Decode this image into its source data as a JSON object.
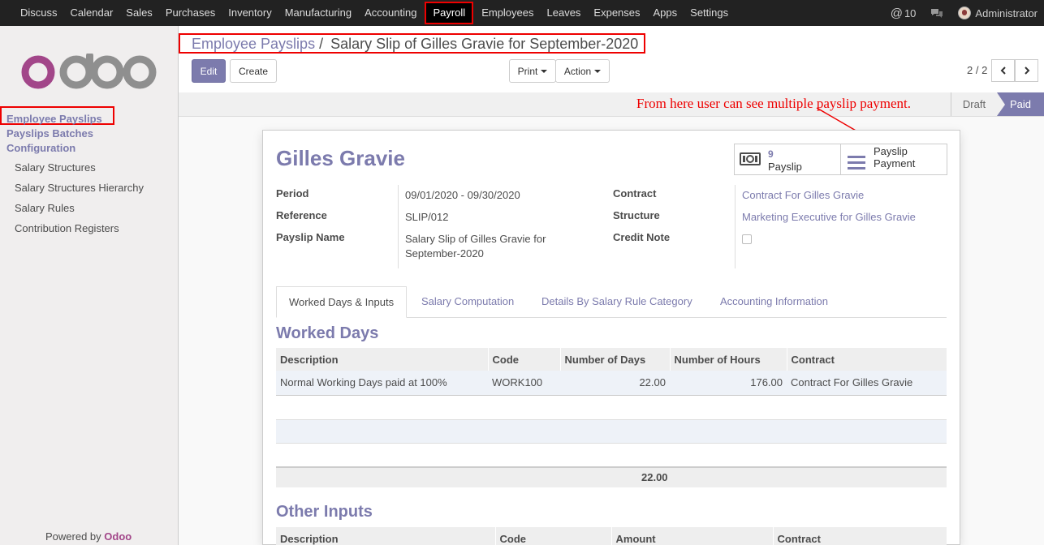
{
  "topbar": {
    "menu": [
      "Discuss",
      "Calendar",
      "Sales",
      "Purchases",
      "Inventory",
      "Manufacturing",
      "Accounting",
      "Payroll",
      "Employees",
      "Leaves",
      "Expenses",
      "Apps",
      "Settings"
    ],
    "active_menu": "Payroll",
    "activity_count": "10",
    "user": "Administrator"
  },
  "sidebar": {
    "logo_text": "odoo",
    "sections": [
      "Employee Payslips",
      "Payslips Batches",
      "Configuration"
    ],
    "config_items": [
      "Salary Structures",
      "Salary Structures Hierarchy",
      "Salary Rules",
      "Contribution Registers"
    ],
    "powered_prefix": "Powered by",
    "powered_brand": "Odoo"
  },
  "control": {
    "breadcrumb_parent": "Employee Payslips",
    "breadcrumb_sep": "/",
    "breadcrumb_current": "Salary Slip of Gilles Gravie for September-2020",
    "edit_label": "Edit",
    "create_label": "Create",
    "print_label": "Print",
    "action_label": "Action",
    "pager": "2 / 2"
  },
  "statusbar": {
    "note": "From here user can see multiple payslip payment.",
    "stages": [
      "Draft",
      "Paid"
    ],
    "current_stage": "Paid"
  },
  "form": {
    "employee": "Gilles Gravie",
    "smart_payslip_count": "9",
    "smart_payslip_label": "Payslip",
    "smart_payment_label_1": "Payslip",
    "smart_payment_label_2": "Payment",
    "period_label": "Period",
    "period_value": "09/01/2020 - 09/30/2020",
    "reference_label": "Reference",
    "reference_value": "SLIP/012",
    "payslip_name_label": "Payslip Name",
    "payslip_name_line1": "Salary Slip of Gilles Gravie for",
    "payslip_name_line2": "September-2020",
    "contract_label": "Contract",
    "contract_value": "Contract For Gilles Gravie",
    "structure_label": "Structure",
    "structure_value": "Marketing Executive for Gilles Gravie",
    "credit_note_label": "Credit Note",
    "credit_note_checked": false
  },
  "tabs": [
    "Worked Days & Inputs",
    "Salary Computation",
    "Details By Salary Rule Category",
    "Accounting Information"
  ],
  "worked_days": {
    "title": "Worked Days",
    "headers": [
      "Description",
      "Code",
      "Number of Days",
      "Number of Hours",
      "Contract"
    ],
    "rows": [
      [
        "Normal Working Days paid at 100%",
        "WORK100",
        "22.00",
        "176.00",
        "Contract For Gilles Gravie"
      ]
    ],
    "total_days": "22.00"
  },
  "other_inputs": {
    "title": "Other Inputs",
    "headers": [
      "Description",
      "Code",
      "Amount",
      "Contract"
    ]
  }
}
